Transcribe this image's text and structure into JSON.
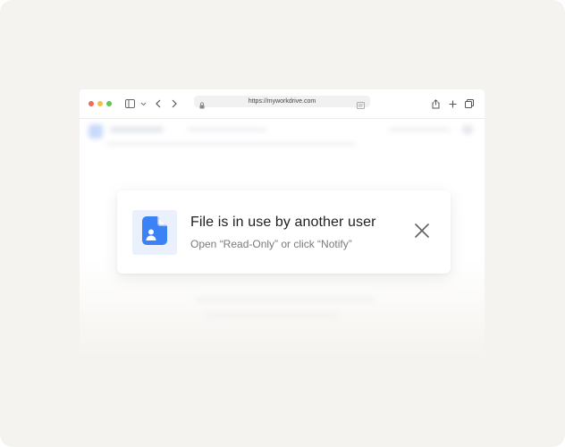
{
  "browser": {
    "url": "https://myworkdrive.com"
  },
  "dialog": {
    "title": "File is in use by another user",
    "subtitle": "Open “Read-Only” or click “Notify”",
    "file_icon": "file-user-icon",
    "close_icon": "close-icon",
    "accent_color": "#3b82f6"
  },
  "colors": {
    "background": "#f4f3ef",
    "icon_tile": "#eaf1fd"
  }
}
